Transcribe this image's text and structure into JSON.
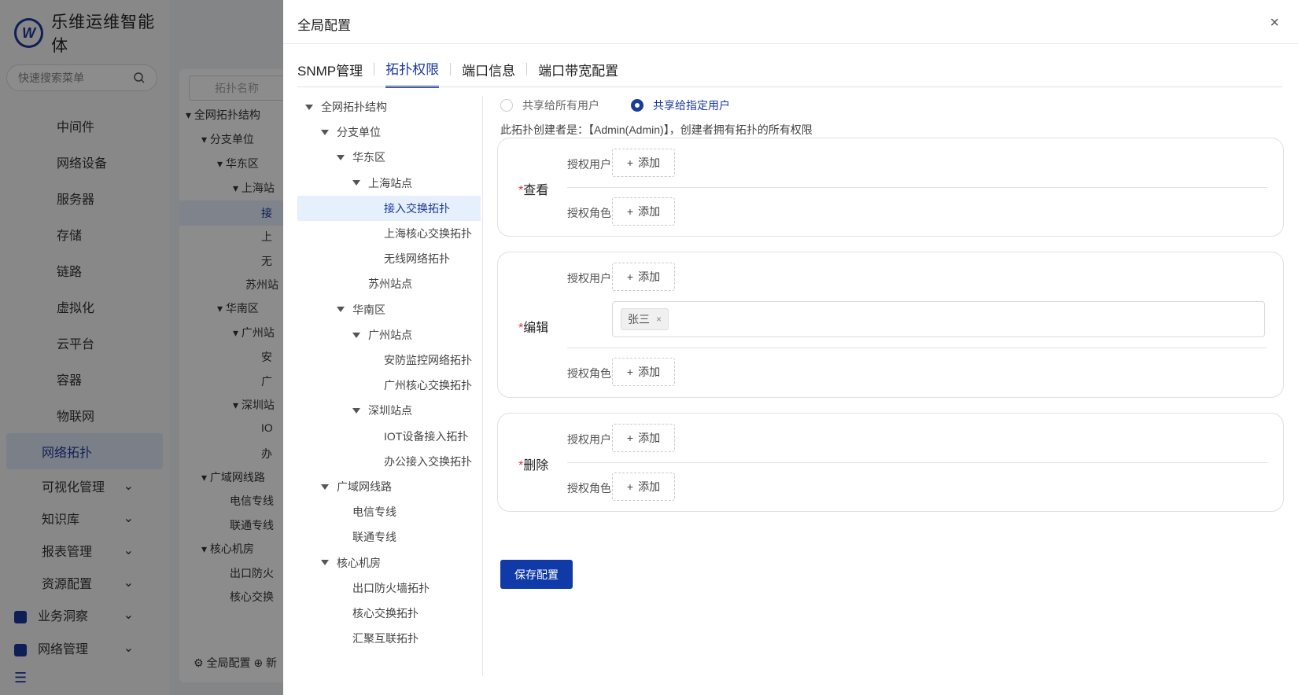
{
  "app": {
    "logo_letter": "W",
    "title": "乐维运维智能体",
    "search_placeholder": "快速搜索菜单"
  },
  "sidebar": {
    "items": [
      {
        "label": "中间件"
      },
      {
        "label": "网络设备"
      },
      {
        "label": "服务器"
      },
      {
        "label": "存储"
      },
      {
        "label": "链路"
      },
      {
        "label": "虚拟化"
      },
      {
        "label": "云平台"
      },
      {
        "label": "容器"
      },
      {
        "label": "物联网"
      }
    ],
    "active_label": "网络拓扑",
    "groups": [
      "可视化管理",
      "知识库",
      "报表管理",
      "资源配置"
    ],
    "groups2": [
      "业务洞察",
      "网络管理"
    ]
  },
  "bg_tree": {
    "search_placeholder": "拓扑名称",
    "nodes": [
      "全网拓扑结构",
      "分支单位",
      "华东区",
      "上海站",
      "接",
      "上",
      "无",
      "苏州站",
      "华南区",
      "广州站",
      "安",
      "广",
      "深圳站",
      "IO",
      "办",
      "广域网线路",
      "电信专线",
      "联通专线",
      "核心机房",
      "出口防火",
      "核心交换"
    ],
    "footer_settings": "全局配置",
    "footer_new": "新"
  },
  "drawer": {
    "title": "全局配置",
    "close": "×",
    "tabs": [
      "SNMP管理",
      "拓扑权限",
      "端口信息",
      "端口带宽配置"
    ],
    "active_tab": 1,
    "tree": [
      {
        "label": "全网拓扑结构",
        "level": 0,
        "caret": true
      },
      {
        "label": "分支单位",
        "level": 1,
        "caret": true
      },
      {
        "label": "华东区",
        "level": 2,
        "caret": true
      },
      {
        "label": "上海站点",
        "level": 3,
        "caret": true
      },
      {
        "label": "接入交换拓扑",
        "level": 4,
        "caret": false,
        "selected": true
      },
      {
        "label": "上海核心交换拓扑",
        "level": 4,
        "caret": false
      },
      {
        "label": "无线网络拓扑",
        "level": 4,
        "caret": false
      },
      {
        "label": "苏州站点",
        "level": 3,
        "caret": false
      },
      {
        "label": "华南区",
        "level": 2,
        "caret": true
      },
      {
        "label": "广州站点",
        "level": 3,
        "caret": true
      },
      {
        "label": "安防监控网络拓扑",
        "level": 4,
        "caret": false
      },
      {
        "label": "广州核心交换拓扑",
        "level": 4,
        "caret": false
      },
      {
        "label": "深圳站点",
        "level": 3,
        "caret": true
      },
      {
        "label": "IOT设备接入拓扑",
        "level": 4,
        "caret": false
      },
      {
        "label": "办公接入交换拓扑",
        "level": 4,
        "caret": false
      },
      {
        "label": "广域网线路",
        "level": 1,
        "caret": true
      },
      {
        "label": "电信专线",
        "level": 2,
        "caret": false
      },
      {
        "label": "联通专线",
        "level": 2,
        "caret": false
      },
      {
        "label": "核心机房",
        "level": 1,
        "caret": true
      },
      {
        "label": "出口防火墙拓扑",
        "level": 2,
        "caret": false
      },
      {
        "label": "核心交换拓扑",
        "level": 2,
        "caret": false
      },
      {
        "label": "汇聚互联拓扑",
        "level": 2,
        "caret": false
      }
    ],
    "share": {
      "all_label": "共享给所有用户",
      "specific_label": "共享给指定用户",
      "selected": "specific"
    },
    "creator_text": "此拓扑创建者是：【Admin(Admin)】，创建者拥有拓扑的所有权限",
    "required_mark": "*",
    "perms": {
      "view": {
        "label": "查看"
      },
      "edit": {
        "label": "编辑",
        "user_tags": [
          "张三"
        ]
      },
      "delete": {
        "label": "删除"
      }
    },
    "user_label": "授权用户",
    "role_label": "授权角色",
    "add_label": "添加",
    "add_icon": "+",
    "tag_close": "×",
    "save_label": "保存配置"
  }
}
